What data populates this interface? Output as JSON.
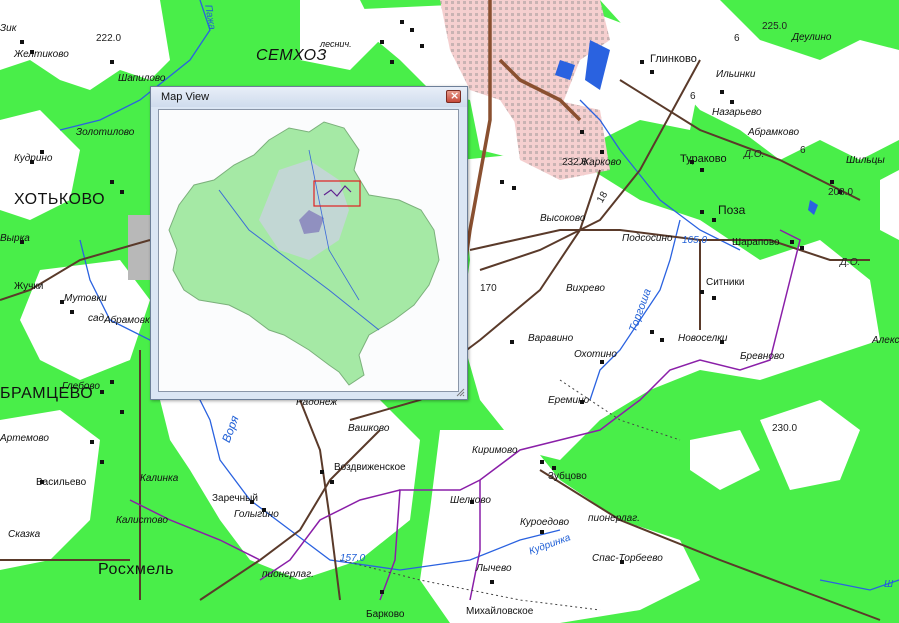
{
  "map": {
    "towns": {
      "semkhoz": "СЕМХОЗ",
      "khotkovo": "ХОТЬКОВО",
      "abramtsevo": "БРАМЦЕВО",
      "roskhmel": "Росхмель"
    },
    "villages": {
      "glinkovo": "Глинково",
      "ilinki": "Ильинки",
      "deulino": "Деулино",
      "nazarevo": "Назарьево",
      "abramkovo": "Абрамково",
      "turakovo": "Тураково",
      "shilcy": "Шильцы",
      "zharkovo": "Жарково",
      "poza": "Поза",
      "sharapovo": "Шарапово",
      "podsosino": "Подсосино",
      "vysokovo": "Высоково",
      "vikhrevo": "Вихрево",
      "sitniki": "Ситники",
      "varavino": "Варавино",
      "okhotino": "Охотино",
      "novoselki": "Новоселки",
      "brevnovo": "Бревново",
      "aleks": "Алекс",
      "eremino": "Еремино",
      "kirimovo": "Киримово",
      "zubtsovo": "Зубцово",
      "shelkovo": "Шелково",
      "kurovedovo": "Куроедово",
      "pionerlag1": "пионерлаг.",
      "spastorbeevo": "Спас-Торбеево",
      "lychevo": "Лычево",
      "mikhaylovskoe": "Михайловское",
      "barkovo": "Барково",
      "vozdvizhenskoe": "Воздвиженское",
      "vashkovo": "Вашково",
      "radonezh": "Радонеж",
      "zarechny": "Заречный",
      "golygino": "Голыгино",
      "pionerlag2": "пионерлаг.",
      "vasilevo": "Васильево",
      "kalistovo": "Калистово",
      "skazka": "Сказка",
      "artemovo": "Артемово",
      "gorbovo": "Глебово",
      "abramovka": "Абрамовка",
      "zhuchki": "Жучки",
      "mutovki": "Мутовки",
      "kudrino": "Кудрино",
      "zolotilovo": "Золотилово",
      "shapilovo": "Шапилово",
      "zheltikovo": "Желтиково",
      "vyrka": "Вырка",
      "sad": "сад.",
      "lesnich": "леснич.",
      "kalinka": "Калинка",
      "vikhrevo2": "Вихрево",
      "zik": "Зик"
    },
    "rivers": {
      "vorya": "Воря",
      "torgosha": "Торгоша",
      "pazha": "Пажа",
      "kudrinka": "Кудринка",
      "sh": "Ш"
    },
    "elevations": {
      "e225": "225.0",
      "e222": "222.0",
      "e208": "208.0",
      "e230": "230.0",
      "e232": "232.0",
      "e165": "165.0",
      "e170": "170",
      "e157": "157.0"
    },
    "road_numbers": {
      "r6a": "6",
      "r6b": "6",
      "r6c": "6",
      "r18": "18",
      "do1": "Д.О.",
      "do2": "Д.О."
    },
    "colors": {
      "forest": "#4ef04e",
      "open": "#ffffff",
      "water": "#2a62e0",
      "road": "#5a3a2a",
      "urban": "#f3c6c6",
      "boundary": "#8a1fa8"
    }
  },
  "map_view": {
    "title": "Map View",
    "close_icon": "close-icon",
    "resize_icon": "resize-grip-icon"
  }
}
